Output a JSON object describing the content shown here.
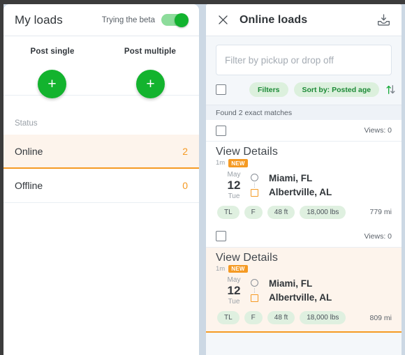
{
  "left_panel": {
    "title": "My loads",
    "beta_label": "Trying the beta",
    "beta_toggle_state": "on",
    "post_single_label": "Post single",
    "post_multiple_label": "Post multiple",
    "add_icon_glyph": "+",
    "status_heading": "Status",
    "status_rows": [
      {
        "label": "Online",
        "count": "2",
        "active": true
      },
      {
        "label": "Offline",
        "count": "0",
        "active": false
      }
    ]
  },
  "right_panel": {
    "title": "Online loads",
    "close_icon": "close-icon",
    "download_icon": "download-icon",
    "search": {
      "placeholder": "Filter by pickup or drop off",
      "value": ""
    },
    "controls": {
      "filters_label": "Filters",
      "sort_label": "Sort by: Posted age",
      "sort_icon": "sort-arrows-icon"
    },
    "found_text": "Found 2 exact matches",
    "cards": [
      {
        "views": "Views: 0",
        "title": "View Details",
        "age": "1m",
        "badge": "NEW",
        "date_month": "May",
        "date_day": "12",
        "date_dow": "Tue",
        "origin": "Miami, FL",
        "destination": "Albertville, AL",
        "chips": [
          "TL",
          "F",
          "48 ft",
          "18,000 lbs"
        ],
        "miles": "779 mi",
        "selected": false
      },
      {
        "views": "Views: 0",
        "title": "View Details",
        "age": "1m",
        "badge": "NEW",
        "date_month": "May",
        "date_day": "12",
        "date_dow": "Tue",
        "origin": "Miami, FL",
        "destination": "Albertville, AL",
        "chips": [
          "TL",
          "F",
          "48 ft",
          "18,000 lbs"
        ],
        "miles": "809 mi",
        "selected": true
      }
    ]
  },
  "colors": {
    "accent_green": "#13b32e",
    "accent_orange": "#f59a23",
    "chip_green_bg": "#dff0e0",
    "selected_bg": "#fdf4ec",
    "panel_bg": "#f4f7fa"
  }
}
